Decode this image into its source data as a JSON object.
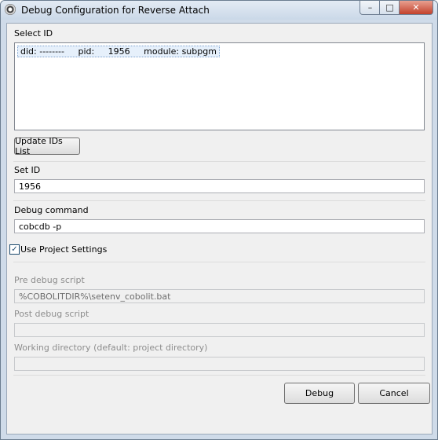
{
  "window": {
    "title": "Debug Configuration for Reverse Attach",
    "minimize_glyph": "–",
    "maximize_glyph": "□",
    "close_glyph": "✕"
  },
  "select_id": {
    "label": "Select ID",
    "list_items": [
      "did: --------     pid:     1956     module: subpgm"
    ],
    "update_button": "Update IDs List"
  },
  "set_id": {
    "label": "Set ID",
    "value": "1956"
  },
  "debug_command": {
    "label": "Debug command",
    "value": "cobcdb -p"
  },
  "use_project_settings": {
    "label": "Use Project Settings",
    "checked": true,
    "check_glyph": "✓"
  },
  "pre_debug": {
    "label": "Pre debug script",
    "value": "%COBOLITDIR%\\setenv_cobolit.bat"
  },
  "post_debug": {
    "label": "Post debug script",
    "value": ""
  },
  "working_dir": {
    "label": "Working directory (default: project directory)",
    "value": ""
  },
  "buttons": {
    "debug": "Debug",
    "cancel": "Cancel"
  }
}
